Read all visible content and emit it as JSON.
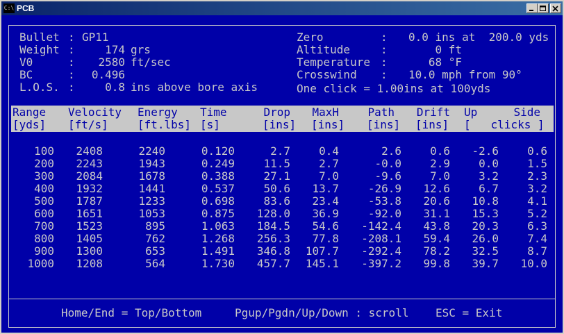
{
  "window": {
    "title": "PCB",
    "icon": "C:\\"
  },
  "info_left": [
    {
      "label": "Bullet",
      "sep": ":",
      "value": "GP11",
      "unit": ""
    },
    {
      "label": "Weight",
      "sep": ":",
      "value": "174",
      "unit": "grs"
    },
    {
      "label": "V0",
      "sep": ":",
      "value": "2580",
      "unit": "ft/sec"
    },
    {
      "label": "BC",
      "sep": ":",
      "value": "0.496",
      "unit": ""
    },
    {
      "label": "L.O.S.",
      "sep": ":",
      "value": "0.8",
      "unit": "ins above bore axis"
    }
  ],
  "info_right": [
    {
      "label": "Zero",
      "sep": ":",
      "value": "0.0 ins at  200.0 yds"
    },
    {
      "label": "Altitude",
      "sep": ":",
      "value": "    0 ft"
    },
    {
      "label": "Temperature",
      "sep": ":",
      "value": "   68 °F"
    },
    {
      "label": "Crosswind",
      "sep": ":",
      "value": "10.0 mph from 90°"
    }
  ],
  "click_info": "One click = 1.00ins at 100yds",
  "columns": [
    {
      "name": "Range",
      "unit": "[yds]"
    },
    {
      "name": "Velocity",
      "unit": "[ft/s]"
    },
    {
      "name": "Energy",
      "unit": "[ft.lbs]"
    },
    {
      "name": "Time",
      "unit": "[s]"
    },
    {
      "name": "Drop",
      "unit": "[ins]"
    },
    {
      "name": "MaxH",
      "unit": "[ins]"
    },
    {
      "name": "Path",
      "unit": "[ins]"
    },
    {
      "name": "Drift",
      "unit": "[ins]"
    },
    {
      "name": "Up",
      "unit": ""
    },
    {
      "name": "Side",
      "unit": ""
    }
  ],
  "clicks_unit": "[   clicks ]",
  "rows": [
    [
      "100",
      "2408",
      "2240",
      "0.120",
      "2.7",
      "0.4",
      "2.6",
      "0.6",
      "-2.6",
      "0.6"
    ],
    [
      "200",
      "2243",
      "1943",
      "0.249",
      "11.5",
      "2.7",
      "-0.0",
      "2.9",
      "0.0",
      "1.5"
    ],
    [
      "300",
      "2084",
      "1678",
      "0.388",
      "27.1",
      "7.0",
      "-9.6",
      "7.0",
      "3.2",
      "2.3"
    ],
    [
      "400",
      "1932",
      "1441",
      "0.537",
      "50.6",
      "13.7",
      "-26.9",
      "12.6",
      "6.7",
      "3.2"
    ],
    [
      "500",
      "1787",
      "1233",
      "0.698",
      "83.6",
      "23.4",
      "-53.8",
      "20.6",
      "10.8",
      "4.1"
    ],
    [
      "600",
      "1651",
      "1053",
      "0.875",
      "128.0",
      "36.9",
      "-92.0",
      "31.1",
      "15.3",
      "5.2"
    ],
    [
      "700",
      "1523",
      "895",
      "1.063",
      "184.5",
      "54.6",
      "-142.4",
      "43.8",
      "20.3",
      "6.3"
    ],
    [
      "800",
      "1405",
      "762",
      "1.268",
      "256.3",
      "77.8",
      "-208.1",
      "59.4",
      "26.0",
      "7.4"
    ],
    [
      "900",
      "1300",
      "653",
      "1.491",
      "346.8",
      "107.7",
      "-292.4",
      "78.2",
      "32.5",
      "8.7"
    ],
    [
      "1000",
      "1208",
      "564",
      "1.730",
      "457.7",
      "145.1",
      "-397.2",
      "99.8",
      "39.7",
      "10.0"
    ]
  ],
  "footer": {
    "home_end": "Home/End = Top/Bottom",
    "scroll": "Pgup/Pgdn/Up/Down : scroll",
    "exit": "ESC = Exit"
  },
  "colors": {
    "background": "#0000a8",
    "foreground": "#c8c8c8"
  }
}
